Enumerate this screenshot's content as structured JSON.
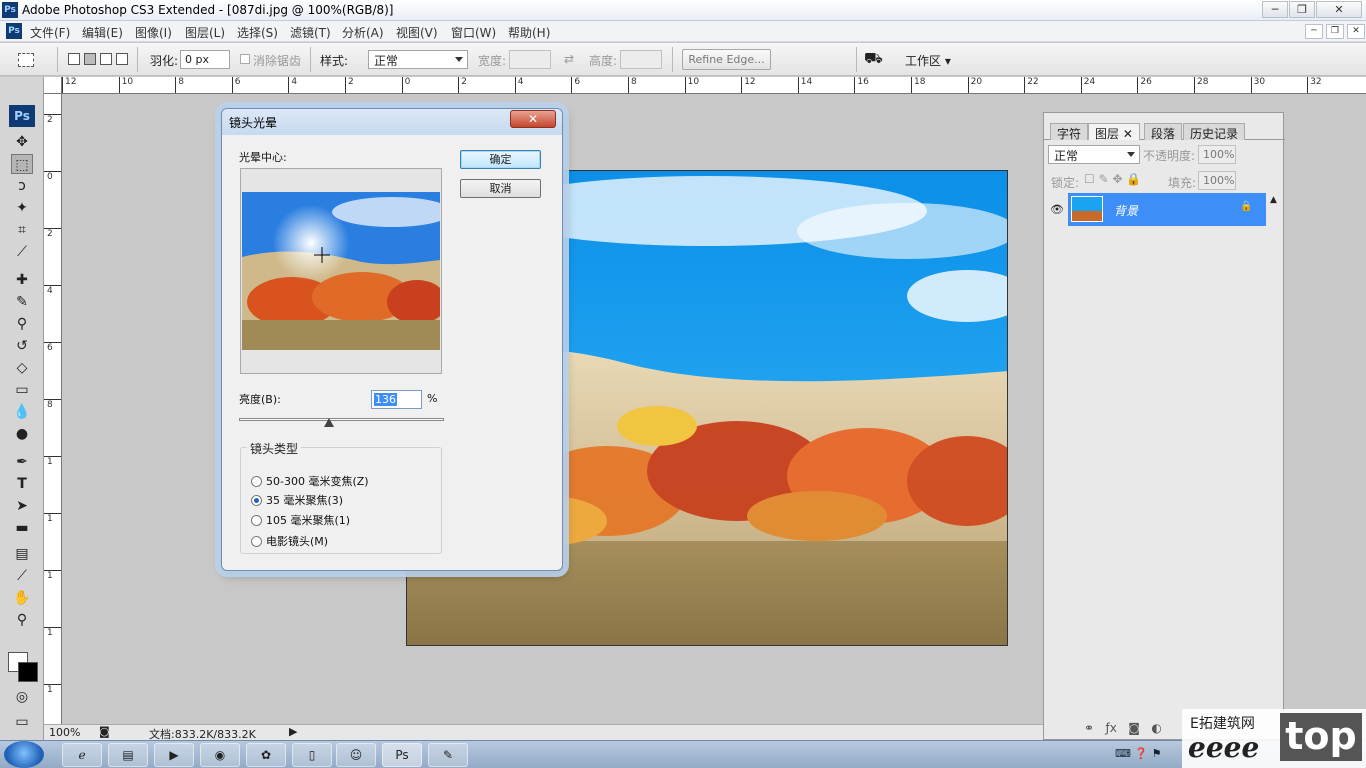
{
  "window": {
    "title": "Adobe Photoshop CS3 Extended - [087di.jpg @ 100%(RGB/8)]",
    "ps_badge": "Ps",
    "min": "─",
    "max": "❐",
    "close": "✕"
  },
  "menu": {
    "items": [
      "文件(F)",
      "编辑(E)",
      "图像(I)",
      "图层(L)",
      "选择(S)",
      "滤镜(T)",
      "分析(A)",
      "视图(V)",
      "窗口(W)",
      "帮助(H)"
    ]
  },
  "options": {
    "feather_label": "羽化:",
    "feather_value": "0 px",
    "antialias_label": "消除锯齿",
    "style_label": "样式:",
    "style_value": "正常",
    "width_label": "宽度:",
    "height_label": "高度:",
    "refine_edge": "Refine Edge...",
    "workspace": "工作区"
  },
  "ruler": {
    "h_ticks": [
      "12",
      "10",
      "8",
      "6",
      "4",
      "2",
      "0",
      "2",
      "4",
      "6",
      "8",
      "10",
      "12",
      "14",
      "16",
      "18",
      "20",
      "22",
      "24",
      "26",
      "28",
      "30",
      "32"
    ],
    "v_ticks": [
      "2",
      "0",
      "2",
      "4",
      "6",
      "8",
      "1",
      "1",
      "1",
      "1",
      "1"
    ]
  },
  "status": {
    "zoom": "100%",
    "doc": "文档:833.2K/833.2K"
  },
  "layers_panel": {
    "tabs": [
      "字符",
      "图层",
      "段落",
      "历史记录"
    ],
    "blend_mode": "正常",
    "opacity_label": "不透明度:",
    "opacity_value": "100%",
    "lock_label": "锁定:",
    "fill_label": "填充:",
    "fill_value": "100%",
    "layer_name": "背景"
  },
  "dialog": {
    "title": "镜头光晕",
    "close": "✕",
    "center_label": "光晕中心:",
    "ok": "确定",
    "cancel": "取消",
    "brightness_label": "亮度(B):",
    "brightness_value": "136",
    "percent": "%",
    "brightness_fraction": 0.44,
    "lens_group": "镜头类型",
    "lens_options": [
      "50-300 毫米变焦(Z)",
      "35 毫米聚焦(3)",
      "105 毫米聚焦(1)",
      "电影镜头(M)"
    ],
    "lens_selected": 1
  },
  "watermark": {
    "top": "E拓建筑网",
    "bottom": "eeee",
    "tag": "top"
  },
  "colors": {
    "accent": "#3d8ef6",
    "sky": "#1aa3f0",
    "autumn": "#d9531e"
  }
}
